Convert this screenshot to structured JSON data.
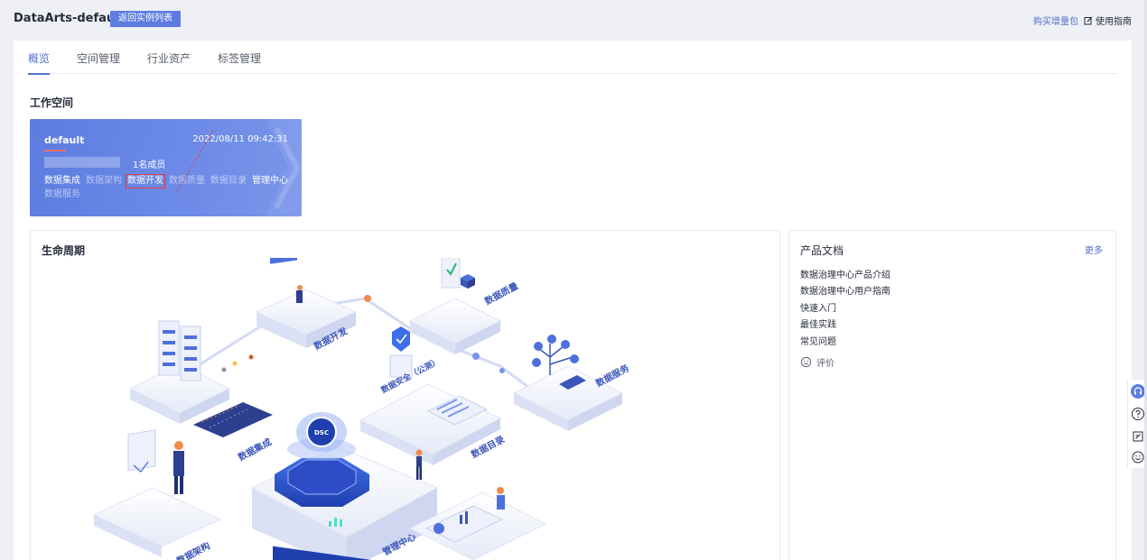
{
  "header": {
    "title": "DataArts-default",
    "back_label": "返回实例列表",
    "buy_label": "购买增量包",
    "guide_label": "使用指南"
  },
  "tabs": [
    {
      "label": "概览",
      "active": true
    },
    {
      "label": "空间管理",
      "active": false
    },
    {
      "label": "行业资产",
      "active": false
    },
    {
      "label": "标签管理",
      "active": false
    }
  ],
  "workspace": {
    "section_title": "工作空间",
    "name": "default",
    "date": "2022/08/11 09:42:31",
    "members": "1名成员",
    "links": [
      "数据集成",
      "数据架构",
      "数据开发",
      "数据质量",
      "数据目录",
      "管理中心",
      "数据服务"
    ],
    "highlighted_link": "数据开发"
  },
  "lifecycle": {
    "title": "生命周期",
    "labels": {
      "dev": "数据开发",
      "quality": "数据质量",
      "service": "数据服务",
      "integration": "数据集成",
      "security": "数据安全（公测）",
      "catalog": "数据目录",
      "management": "管理中心",
      "architecture": "数据架构",
      "core": "DSC"
    }
  },
  "docs": {
    "title": "产品文档",
    "more_label": "更多",
    "items": [
      "数据治理中心产品介绍",
      "数据治理中心用户指南",
      "快速入门",
      "最佳实践",
      "常见问题"
    ],
    "rate_label": "评价"
  },
  "colors": {
    "primary": "#5e7ce0",
    "link": "#526ecc",
    "highlight_box": "#e03c3c"
  }
}
